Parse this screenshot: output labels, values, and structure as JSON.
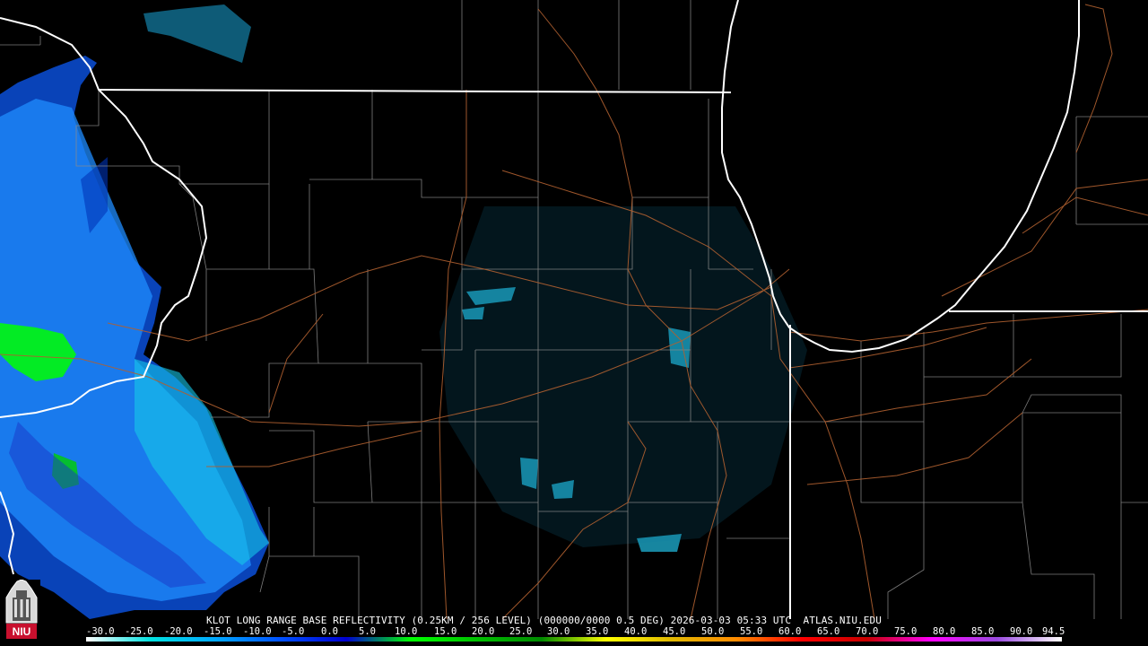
{
  "product": {
    "title": "KLOT LONG RANGE BASE REFLECTIVITY (0.25KM / 256 LEVEL) (000000/0000 0.5 DEG) 2026-03-03 05:33 UTC  ATLAS.NIU.EDU"
  },
  "legend": {
    "labels": [
      "-30.0",
      "-25.0",
      "-20.0",
      "-15.0",
      "-10.0",
      "-5.0",
      "0.0",
      "5.0",
      "10.0",
      "15.0",
      "20.0",
      "25.0",
      "30.0",
      "35.0",
      "40.0",
      "45.0",
      "50.0",
      "55.0",
      "60.0",
      "65.0",
      "70.0",
      "75.0",
      "80.0",
      "85.0",
      "90.0",
      "94.5"
    ],
    "colors": [
      "#ffffff",
      "#00e0e0",
      "#00a8ff",
      "#0050ff",
      "#0000d0",
      "#00ff00",
      "#00c000",
      "#008a00",
      "#ffff00",
      "#e0b800",
      "#ff8c00",
      "#ff0000",
      "#c80000",
      "#ff00ff",
      "#9a4adf",
      "#ffffff"
    ]
  },
  "logo": {
    "text": "NIU",
    "color": "#c8102e"
  }
}
